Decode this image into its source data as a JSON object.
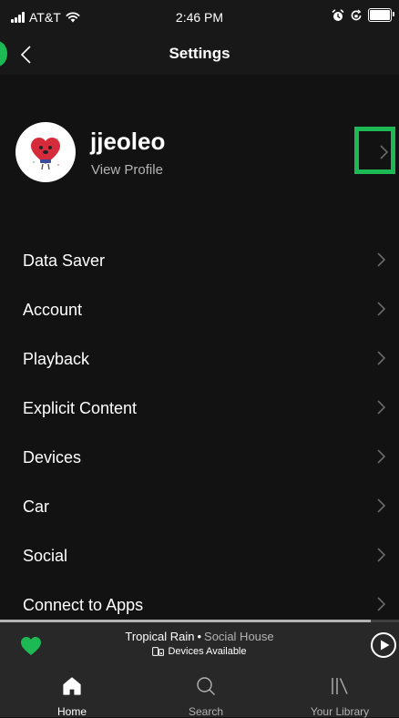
{
  "status_bar": {
    "carrier": "AT&T",
    "time": "2:46 PM"
  },
  "header": {
    "title": "Settings"
  },
  "profile": {
    "name": "jjeoleo",
    "subtitle": "View Profile"
  },
  "settings": [
    {
      "label": "Data Saver"
    },
    {
      "label": "Account"
    },
    {
      "label": "Playback"
    },
    {
      "label": "Explicit Content"
    },
    {
      "label": "Devices"
    },
    {
      "label": "Car"
    },
    {
      "label": "Social"
    },
    {
      "label": "Connect to Apps"
    }
  ],
  "now_playing": {
    "title": "Tropical Rain",
    "separator": "•",
    "artist": "Social House",
    "devices": "Devices Available",
    "progress_percent": 93
  },
  "nav": [
    {
      "label": "Home",
      "icon": "home-icon",
      "active": true
    },
    {
      "label": "Search",
      "icon": "search-icon",
      "active": false
    },
    {
      "label": "Your Library",
      "icon": "library-icon",
      "active": false
    }
  ],
  "colors": {
    "accent": "#1db954",
    "background": "#121212",
    "header": "#181818",
    "player": "#282828",
    "muted_text": "#b3b3b3",
    "chevron": "#6a6a6a"
  }
}
